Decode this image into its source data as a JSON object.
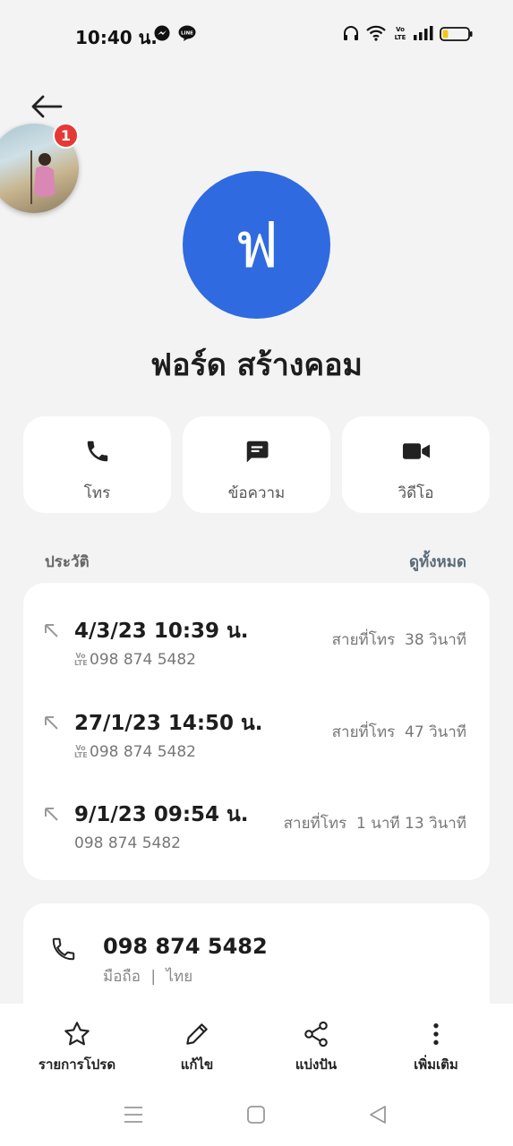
{
  "status_bar": {
    "time": "10:40 น.",
    "battery_color": "#f5c518"
  },
  "bubble": {
    "badge_count": "1"
  },
  "contact": {
    "initial": "ฟ",
    "name": "ฟอร์ด สร้างคอม",
    "avatar_color": "#2f6ae1"
  },
  "actions": [
    {
      "label": "โทร",
      "icon": "phone-icon"
    },
    {
      "label": "ข้อความ",
      "icon": "message-icon"
    },
    {
      "label": "วิดีโอ",
      "icon": "video-icon"
    }
  ],
  "history": {
    "title": "ประวัติ",
    "view_all": "ดูทั้งหมด",
    "calls": [
      {
        "date": "4/3/23 10:39 น.",
        "number": "098 874 5482",
        "volte": true,
        "type": "สายที่โทร",
        "duration": "38 วินาที"
      },
      {
        "date": "27/1/23 14:50 น.",
        "number": "098 874 5482",
        "volte": true,
        "type": "สายที่โทร",
        "duration": "47 วินาที"
      },
      {
        "date": "9/1/23 09:54 น.",
        "number": "098 874 5482",
        "volte": false,
        "type": "สายที่โทร",
        "duration": "1 นาที 13 วินาที"
      }
    ]
  },
  "number_card": {
    "number": "098 874 5482",
    "label": "มือถือ",
    "separator": "|",
    "region": "ไทย"
  },
  "bottom_bar": {
    "favorite": "รายการโปรด",
    "edit": "แก้ไข",
    "share": "แบ่งปัน",
    "more": "เพิ่มเติม"
  }
}
